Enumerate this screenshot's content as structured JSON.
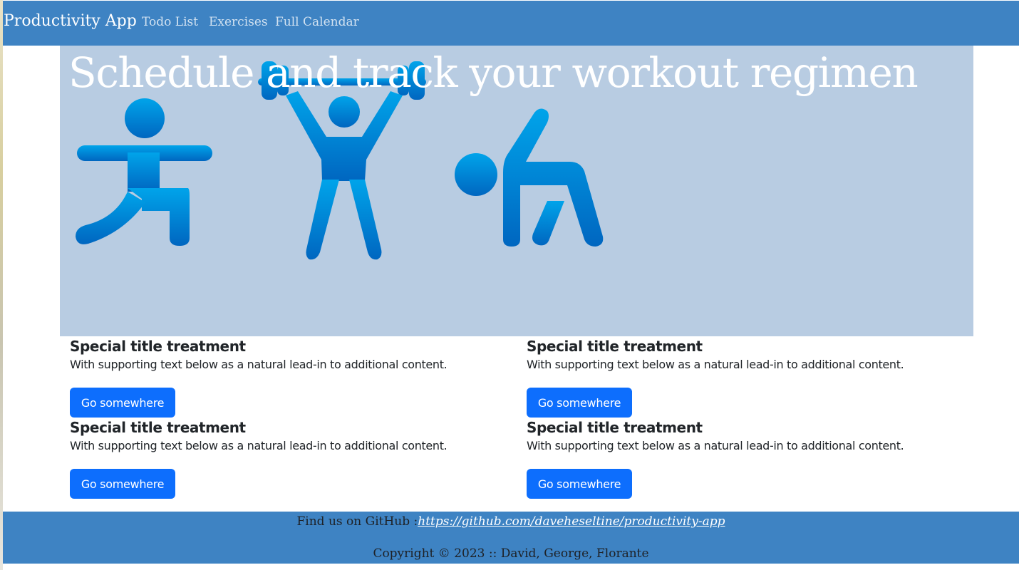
{
  "navbar": {
    "brand": "Productivity App",
    "links": [
      {
        "label": "Todo List"
      },
      {
        "label": "Exercises"
      },
      {
        "label": "Full Calendar"
      }
    ]
  },
  "hero": {
    "title": "Schedule and track your workout regimen",
    "icons": [
      "lunge-figure-icon",
      "weightlifting-figure-icon",
      "stretching-figure-icon"
    ]
  },
  "cards": [
    {
      "title": "Special title treatment",
      "text": "With supporting text below as a natural lead-in to additional content.",
      "button": "Go somewhere"
    },
    {
      "title": "Special title treatment",
      "text": "With supporting text below as a natural lead-in to additional content.",
      "button": "Go somewhere"
    },
    {
      "title": "Special title treatment",
      "text": "With supporting text below as a natural lead-in to additional content.",
      "button": "Go somewhere"
    },
    {
      "title": "Special title treatment",
      "text": "With supporting text below as a natural lead-in to additional content.",
      "button": "Go somewhere"
    }
  ],
  "footer": {
    "github_prefix": "Find us on GitHub :",
    "github_url": "https://github.com/daveheseltine/productivity-app",
    "copyright": "Copyright © 2023 :: David, George, Florante"
  },
  "colors": {
    "navbar": "#3e83c3",
    "hero_background": "#b8cce2",
    "button": "#0d6efd",
    "icon_top": "#00a4ea",
    "icon_bottom": "#0066c0"
  }
}
